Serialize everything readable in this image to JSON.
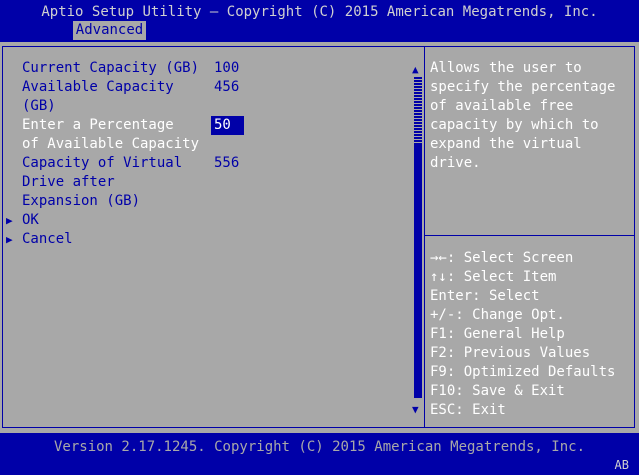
{
  "header": {
    "title": "Aptio Setup Utility – Copyright (C) 2015 American Megatrends, Inc.",
    "tab_label": "Advanced"
  },
  "form": {
    "current_capacity": {
      "label": "Current Capacity (GB)",
      "value": "100"
    },
    "available_capacity": {
      "label_line1": "Available Capacity",
      "label_line2": "(GB)",
      "value": "456"
    },
    "percentage": {
      "label_line1": "Enter a Percentage",
      "label_line2": "of Available Capacity",
      "value": "50"
    },
    "virtual_capacity": {
      "label_line1": "Capacity of Virtual",
      "label_line2": "Drive after",
      "label_line3": "Expansion (GB)",
      "value": "556"
    },
    "ok_label": "OK",
    "cancel_label": "Cancel"
  },
  "help": {
    "lines": [
      "Allows the user to",
      "specify the percentage",
      "of available free",
      "capacity by which to",
      "expand the virtual",
      "drive."
    ]
  },
  "keys": {
    "lines": [
      "→←: Select Screen",
      "↑↓: Select Item",
      "Enter: Select",
      "+/-: Change Opt.",
      "F1: General Help",
      "F2: Previous Values",
      "F9: Optimized Defaults",
      "F10: Save & Exit",
      "ESC: Exit"
    ]
  },
  "footer": {
    "version": "Version 2.17.1245. Copyright (C) 2015 American Megatrends, Inc.",
    "badge": "AB"
  },
  "colors": {
    "bios_blue": "#0000a8",
    "bios_gray": "#a8a8a8",
    "bios_white": "#ffffff"
  }
}
